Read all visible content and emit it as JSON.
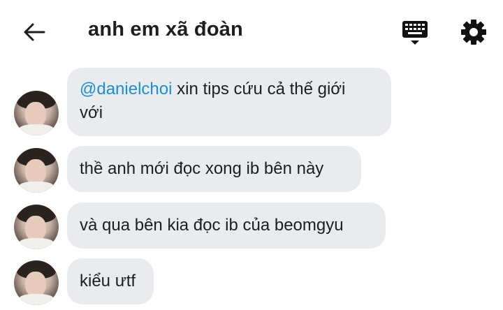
{
  "header": {
    "title": "anh em xã đoàn",
    "back_icon": "arrow-left-icon",
    "keyboard_icon": "keyboard-icon",
    "settings_icon": "gear-icon"
  },
  "messages": [
    {
      "mention": "@danielchoi",
      "text": " xin tips cứu cả thế giới",
      "text2": "với"
    },
    {
      "text": "thề anh mới đọc xong ib bên này"
    },
    {
      "text": "và qua bên kia đọc ib của beomgyu"
    },
    {
      "text": "kiểu ưtf"
    }
  ],
  "colors": {
    "bubble": "#e9ebee",
    "mention": "#1a8fd4",
    "text": "#1c1e21"
  }
}
